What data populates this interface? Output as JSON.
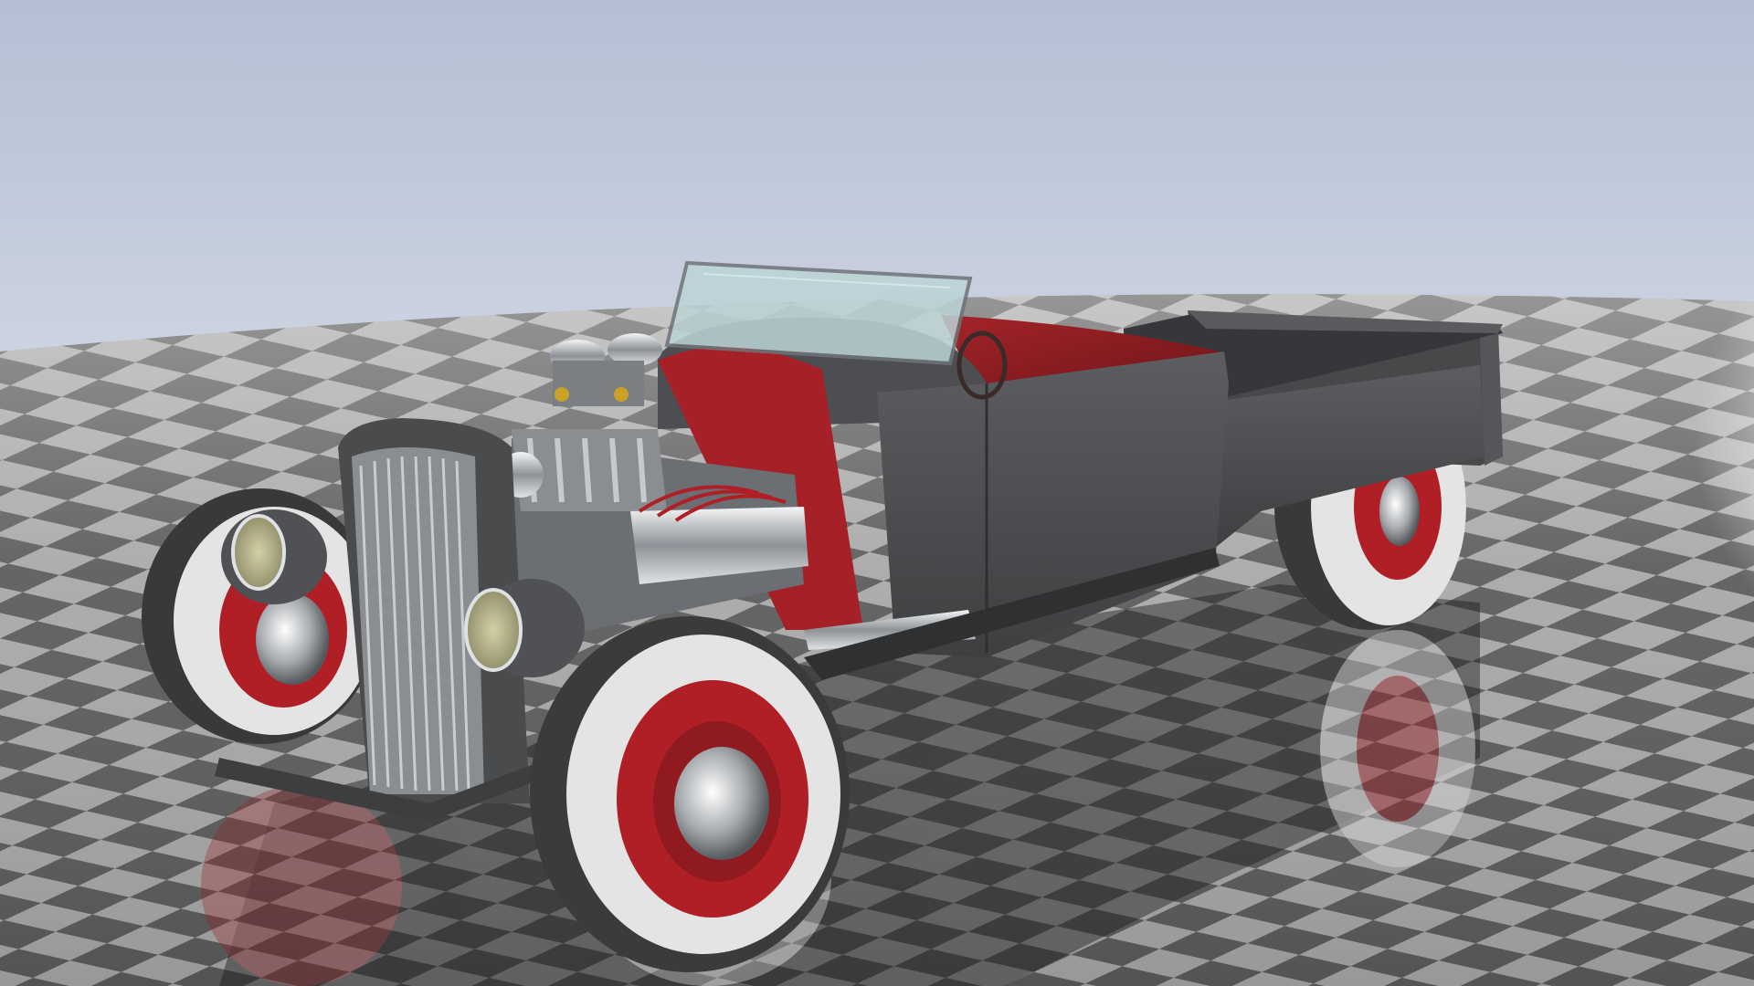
{
  "scene": {
    "subject": "hot-rod-pickup-render",
    "colors": {
      "sky_top": "#b6c1d6",
      "sky_bottom": "#f3f4f7",
      "floor_dark": "#5a5a5a",
      "floor_light": "#a8a8a8",
      "body": "#4a4b4d",
      "interior": "#8e1e22",
      "wheel_rim": "#b01f25",
      "whitewall": "#e6e6e6",
      "tire": "#3a3b3d",
      "chrome": "#d9dcdf",
      "headlight_lens": "#b9b58e",
      "glass": "#b9d3d6"
    }
  }
}
